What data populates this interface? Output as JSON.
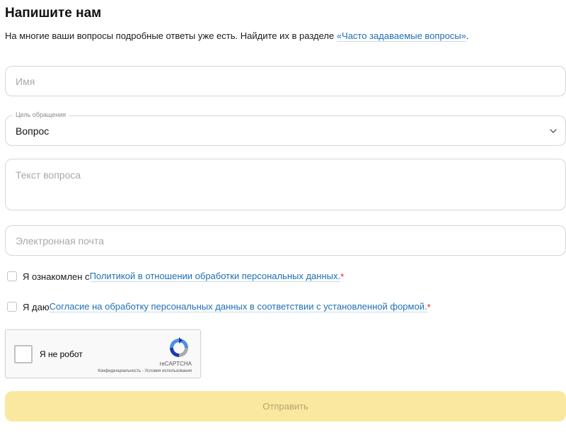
{
  "header": {
    "title": "Напишите нам",
    "intro_text": "На многие ваши вопросы подробные ответы уже есть. Найдите их в разделе ",
    "faq_link": "«Часто задаваемые вопросы»",
    "intro_end": "."
  },
  "form": {
    "name": {
      "placeholder": "Имя"
    },
    "purpose": {
      "legend": "Цель обращения",
      "value": "Вопрос"
    },
    "question": {
      "placeholder": "Текст вопроса"
    },
    "email": {
      "placeholder": "Электронная почта"
    },
    "consent_policy": {
      "prefix": "Я ознакомлен с ",
      "link": "Политикой в отношении обработки персональных данных.",
      "required_mark": "*"
    },
    "consent_data": {
      "prefix": "Я даю ",
      "link": "Согласие на обработку персональных данных в соответствии с установленной формой.",
      "required_mark": "*"
    },
    "captcha": {
      "label": "Я не робот",
      "brand": "reCAPTCHA",
      "terms": "Конфиденциальность - Условия использования"
    },
    "submit_label": "Отправить"
  },
  "colors": {
    "link": "#1f6fb5",
    "required": "#e0262b",
    "submit_bg": "#fbe8a0",
    "submit_text": "#b8a36a"
  }
}
